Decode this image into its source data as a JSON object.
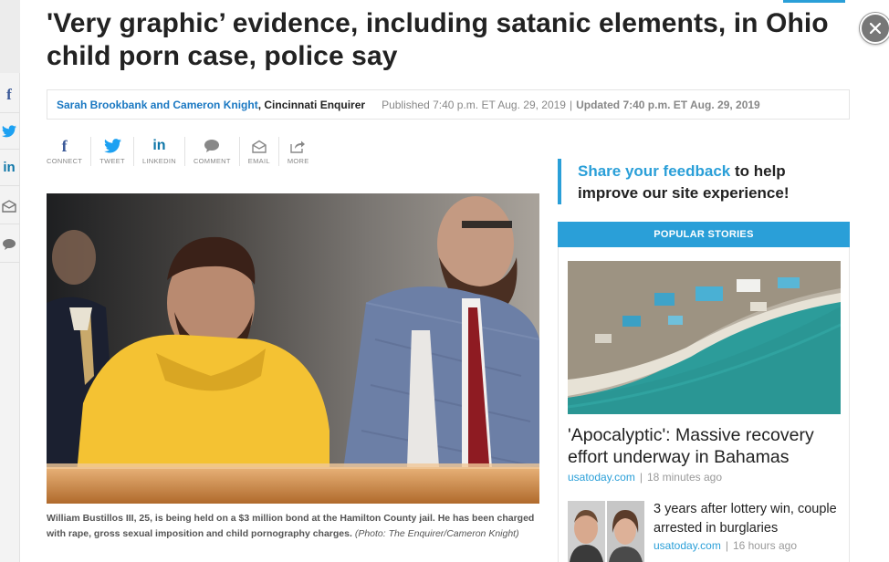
{
  "article": {
    "headline": "'Very graphic’ evidence, including satanic elements, in Ohio child porn case, police say",
    "byline": {
      "authors": "Sarah Brookbank and Cameron Knight",
      "organization": ", Cincinnati Enquirer",
      "published": "Published 7:40 p.m. ET Aug. 29, 2019",
      "separator": "|",
      "updated": "Updated 7:40 p.m. ET Aug. 29, 2019"
    },
    "share_buttons": [
      {
        "label": "CONNECT",
        "icon": "facebook-icon"
      },
      {
        "label": "TWEET",
        "icon": "twitter-icon"
      },
      {
        "label": "LINKEDIN",
        "icon": "linkedin-icon"
      },
      {
        "label": "COMMENT",
        "icon": "comment-icon"
      },
      {
        "label": "EMAIL",
        "icon": "email-icon"
      },
      {
        "label": "MORE",
        "icon": "share-more-icon"
      }
    ],
    "caption": {
      "text": "William Bustillos III, 25, is being held on a $3 million bond at the Hamilton County jail. He has been charged with rape, gross sexual imposition and child pornography charges.",
      "credit": "(Photo: The Enquirer/Cameron Knight)"
    }
  },
  "sidebar": {
    "feedback": {
      "link_text": "Share your feedback",
      "rest_text": " to help improve our site experience!"
    },
    "popular": {
      "header": "POPULAR STORIES",
      "stories": [
        {
          "title": "'Apocalyptic': Massive recovery effort underway in Bahamas",
          "source": "usatoday.com",
          "time": "18 minutes ago"
        },
        {
          "title": "3 years after lottery win, couple arrested in burglaries",
          "source": "usatoday.com",
          "time": "16 hours ago"
        }
      ]
    }
  },
  "left_rail": {
    "icons": [
      "facebook-icon",
      "twitter-icon",
      "linkedin-icon",
      "email-icon",
      "comment-icon"
    ]
  },
  "colors": {
    "accent": "#2a9fd8",
    "link": "#1a78c2",
    "headline": "#222222"
  }
}
